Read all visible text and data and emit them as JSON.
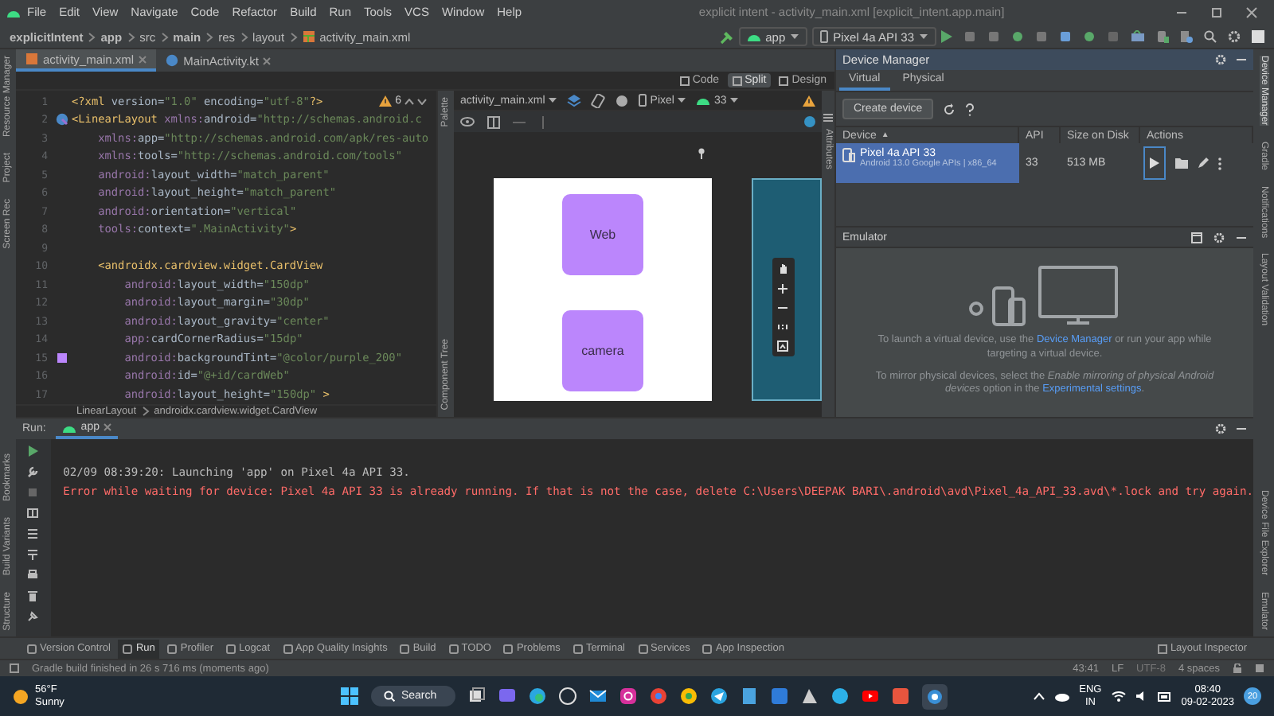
{
  "menu_bar": {
    "items": [
      "File",
      "Edit",
      "View",
      "Navigate",
      "Code",
      "Refactor",
      "Build",
      "Run",
      "Tools",
      "VCS",
      "Window",
      "Help"
    ],
    "title": "explicit intent - activity_main.xml [explicit_intent.app.main]"
  },
  "nav_bar": {
    "breadcrumbs": [
      "explicitIntent",
      "app",
      "src",
      "main",
      "res",
      "layout",
      "activity_main.xml"
    ],
    "run_config": "app",
    "device": "Pixel 4a API 33"
  },
  "left_strip": {
    "top": [
      "Resource Manager",
      "Project",
      "Screen Rec"
    ],
    "bottom": [
      "Bookmarks",
      "Build Variants",
      "Structure"
    ]
  },
  "right_strip": {
    "top": [
      "Device Manager",
      "Gradle",
      "Notifications",
      "Layout Validation"
    ],
    "bottom": [
      "Device File Explorer",
      "Emulator"
    ]
  },
  "editor_tabs": [
    {
      "label": "activity_main.xml",
      "selected": true
    },
    {
      "label": "MainActivity.kt",
      "selected": false
    }
  ],
  "view_modes": [
    {
      "label": "Code",
      "selected": false
    },
    {
      "label": "Split",
      "selected": true
    },
    {
      "label": "Design",
      "selected": false
    }
  ],
  "editor": {
    "warnings": "6",
    "lines": [
      {
        "number": "1",
        "text": "<?xml version=\"1.0\" encoding=\"utf-8\"?>"
      },
      {
        "number": "2",
        "text": "<LinearLayout xmlns:android=\"http://schemas.android.c"
      },
      {
        "number": "3",
        "text": "    xmlns:app=\"http://schemas.android.com/apk/res-auto"
      },
      {
        "number": "4",
        "text": "    xmlns:tools=\"http://schemas.android.com/tools\""
      },
      {
        "number": "5",
        "text": "    android:layout_width=\"match_parent\""
      },
      {
        "number": "6",
        "text": "    android:layout_height=\"match_parent\""
      },
      {
        "number": "7",
        "text": "    android:orientation=\"vertical\""
      },
      {
        "number": "8",
        "text": "    tools:context=\".MainActivity\">"
      },
      {
        "number": "9"
      },
      {
        "number": "10",
        "text": "    <androidx.cardview.widget.CardView"
      },
      {
        "number": "11",
        "text": "        android:layout_width=\"150dp\""
      },
      {
        "number": "12",
        "text": "        android:layout_margin=\"30dp\""
      },
      {
        "number": "13",
        "text": "        android:layout_gravity=\"center\""
      },
      {
        "number": "14",
        "text": "        app:cardCornerRadius=\"15dp\""
      },
      {
        "number": "15",
        "text": "        android:backgroundTint=\"@color/purple_200\""
      },
      {
        "number": "16",
        "text": "        android:id=\"@+id/cardWeb\""
      },
      {
        "number": "17",
        "text": "        android:layout_height=\"150dp\" >"
      }
    ],
    "breadcrumb": [
      "LinearLayout",
      "androidx.cardview.widget.CardView"
    ]
  },
  "preview": {
    "file": "activity_main.xml",
    "device": "Pixel",
    "api": "33",
    "side_panels": [
      "Palette",
      "Component Tree"
    ],
    "attributes_panel": "Attributes",
    "cards": [
      "Web",
      "camera"
    ]
  },
  "device_manager": {
    "title": "Device Manager",
    "tabs": [
      {
        "label": "Virtual",
        "selected": true
      },
      {
        "label": "Physical",
        "selected": false
      }
    ],
    "create_button": "Create device",
    "columns": [
      "Device",
      "API",
      "Size on Disk",
      "Actions"
    ],
    "sort_indicator": "▲",
    "devices": [
      {
        "name": "Pixel 4a API 33",
        "details": "Android 13.0 Google APIs | x86_64",
        "api": "33",
        "size": "513 MB",
        "selected": true
      }
    ]
  },
  "emulator": {
    "title": "Emulator",
    "launch_before": "To launch a virtual device, use the ",
    "launch_link": "Device Manager",
    "launch_after": " or run your app while targeting a virtual device.",
    "mirror_before": "To mirror physical devices, select the *Enable mirroring of physical Android devices* option in the ",
    "mirror_link": "Experimental settings",
    "mirror_after": "."
  },
  "run_panel": {
    "label": "Run:",
    "tab": "app",
    "lines": [
      {
        "kind": "info",
        "text": "02/09 08:39:20: Launching 'app' on Pixel 4a API 33."
      },
      {
        "kind": "error",
        "text": "Error while waiting for device: Pixel 4a API 33 is already running. If that is not the case, delete C:\\Users\\DEEPAK BARI\\.android\\avd\\Pixel_4a_API_33.avd\\*.lock and try again."
      }
    ]
  },
  "tool_windows": [
    {
      "label": "Version Control",
      "selected": false
    },
    {
      "label": "Run",
      "selected": true
    },
    {
      "label": "Profiler",
      "selected": false
    },
    {
      "label": "Logcat",
      "selected": false
    },
    {
      "label": "App Quality Insights",
      "selected": false
    },
    {
      "label": "Build",
      "selected": false
    },
    {
      "label": "TODO",
      "selected": false
    },
    {
      "label": "Problems",
      "selected": false
    },
    {
      "label": "Terminal",
      "selected": false
    },
    {
      "label": "Services",
      "selected": false
    },
    {
      "label": "App Inspection",
      "selected": false
    }
  ],
  "layout_inspector": "Layout Inspector",
  "status_bar": {
    "message": "Gradle build finished in 26 s 716 ms (moments ago)",
    "position": "43:41",
    "line_ending": "LF",
    "encoding": "UTF-8",
    "indent": "4 spaces"
  },
  "taskbar": {
    "temperature": "56°F",
    "weather": "Sunny",
    "search": "Search",
    "language": "ENG",
    "region": "IN",
    "time": "08:40",
    "date": "09-02-2023",
    "notifications": "20"
  }
}
